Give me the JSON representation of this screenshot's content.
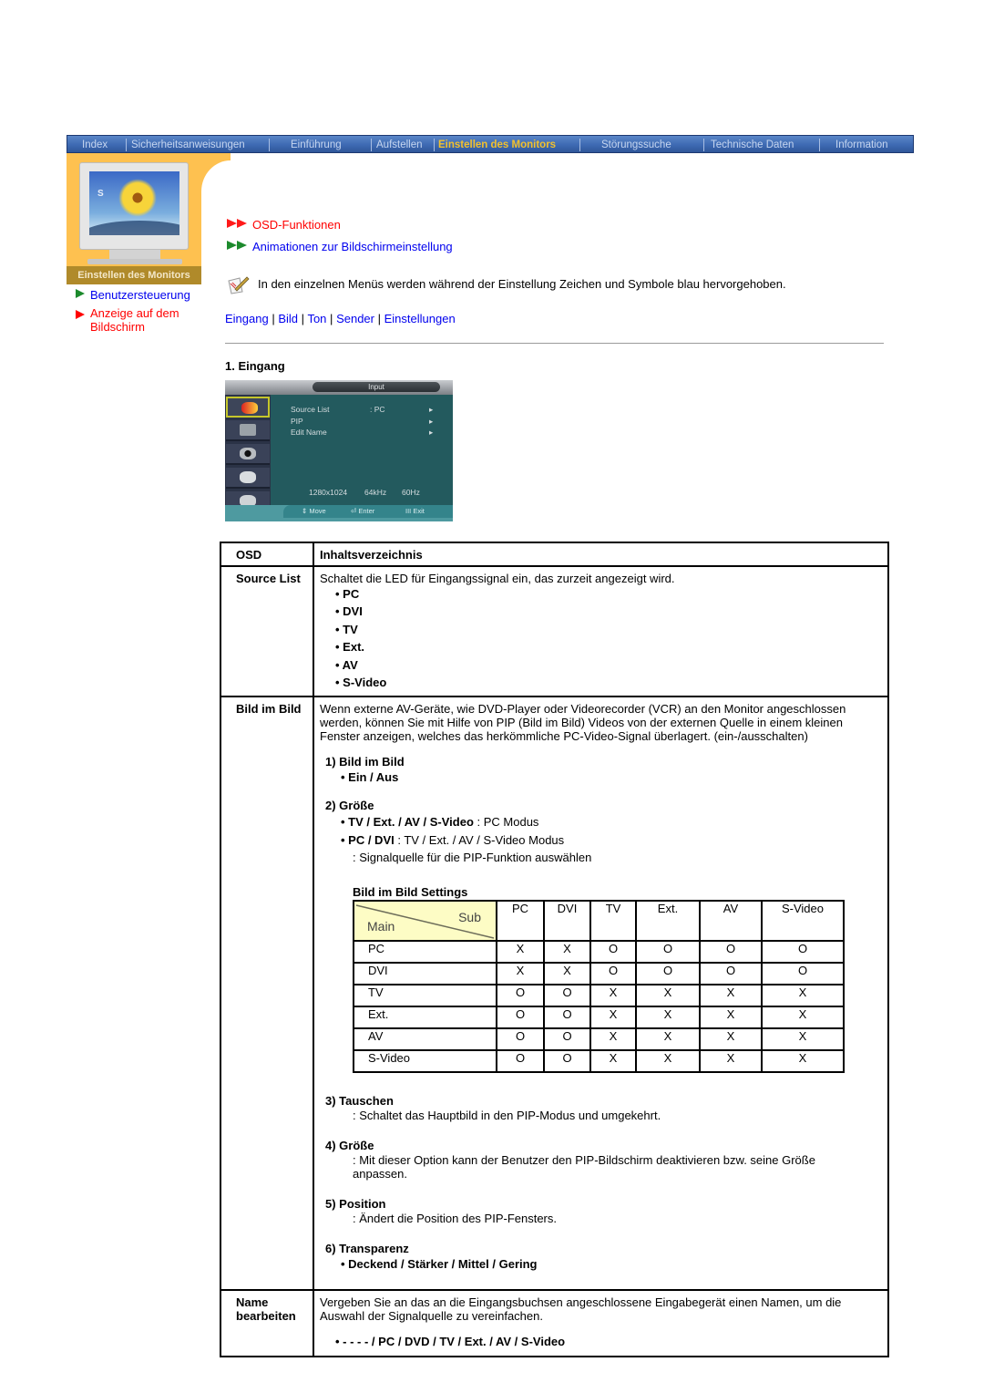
{
  "nav": {
    "items": [
      {
        "label": "Index",
        "active": false
      },
      {
        "label": "Sicherheitsanweisungen",
        "active": false
      },
      {
        "label": "Einführung",
        "active": false
      },
      {
        "label": "Aufstellen",
        "active": false
      },
      {
        "label": "Einstellen des Monitors",
        "active": true
      },
      {
        "label": "Störungssuche",
        "active": false
      },
      {
        "label": "Technische Daten",
        "active": false
      },
      {
        "label": "Information",
        "active": false
      }
    ]
  },
  "sidebar": {
    "panel_title": "Einstellen des Monitors",
    "monitor_letter": "S",
    "links": [
      {
        "label": "Benutzersteuerung",
        "color": "#0000ee",
        "arrow_color": "#1c8a2c"
      },
      {
        "label": "Anzeige auf dem Bildschirm",
        "color": "#ff0000",
        "arrow_color": "#ff0000"
      }
    ]
  },
  "top_links": [
    {
      "label": "OSD-Funktionen",
      "color": "#ff0000",
      "arrow_color": "#ff1a1a"
    },
    {
      "label": "Animationen zur Bildschirmeinstellung",
      "color": "#0000ee",
      "arrow_color": "#1c8a2c"
    }
  ],
  "note": {
    "text": "In den einzelnen Menüs werden während der Einstellung Zeichen und Symbole blau hervorgehoben."
  },
  "breadcrumbs": [
    "Eingang",
    "Bild",
    "Ton",
    "Sender",
    "Einstellungen"
  ],
  "breadcrumb_separator": "|",
  "section_title": "1. Eingang",
  "osd_screen": {
    "title": "Input",
    "menu": [
      {
        "label": "Source List",
        "value": ": PC",
        "arrow": "▸"
      },
      {
        "label": "PIP",
        "value": "",
        "arrow": "▸"
      },
      {
        "label": "Edit Name",
        "value": "",
        "arrow": "▸"
      }
    ],
    "status": [
      "1280x1024",
      "64kHz",
      "60Hz"
    ],
    "footer": [
      "⇕ Move",
      "⏎ Enter",
      "III Exit"
    ]
  },
  "table": {
    "headers": [
      "OSD",
      "Inhaltsverzeichnis"
    ],
    "source_list": {
      "label": "Source List",
      "desc": "Schaltet die LED für Eingangssignal ein, das zurzeit angezeigt wird.",
      "options": [
        "• PC",
        "• DVI",
        "• TV",
        "• Ext.",
        "• AV",
        "• S-Video"
      ]
    },
    "pip": {
      "label": "Bild im Bild",
      "desc": "Wenn externe AV-Geräte, wie DVD-Player oder Videorecorder (VCR) an den Monitor angeschlossen werden, können Sie mit Hilfe von PIP (Bild im Bild) Videos von der externen Quelle in einem kleinen Fenster anzeigen, welches das herkömmliche PC-Video-Signal überlagert. (ein-/ausschalten)",
      "item1_title": "1) Bild im Bild",
      "item1_option": "• Ein / Aus",
      "item2_title": "2) Größe",
      "item2_line1_bold": "• TV / Ext. / AV / S-Video",
      "item2_line1_rest": " : PC Modus",
      "item2_line2_bold": "• PC / DVI",
      "item2_line2_rest": " : TV / Ext. / AV / S-Video Modus",
      "item2_note": ": Signalquelle für die PIP-Funktion auswählen",
      "settings_title": "Bild im Bild Settings",
      "corner_main": "Main",
      "corner_sub": "Sub",
      "columns": [
        "PC",
        "DVI",
        "TV",
        "Ext.",
        "AV",
        "S-Video"
      ],
      "rows": [
        {
          "main": "PC",
          "cells": [
            "X",
            "X",
            "O",
            "O",
            "O",
            "O"
          ]
        },
        {
          "main": "DVI",
          "cells": [
            "X",
            "X",
            "O",
            "O",
            "O",
            "O"
          ]
        },
        {
          "main": "TV",
          "cells": [
            "O",
            "O",
            "X",
            "X",
            "X",
            "X"
          ]
        },
        {
          "main": "Ext.",
          "cells": [
            "O",
            "O",
            "X",
            "X",
            "X",
            "X"
          ]
        },
        {
          "main": "AV",
          "cells": [
            "O",
            "O",
            "X",
            "X",
            "X",
            "X"
          ]
        },
        {
          "main": "S-Video",
          "cells": [
            "O",
            "O",
            "X",
            "X",
            "X",
            "X"
          ]
        }
      ],
      "item3_title": "3) Tauschen",
      "item3_desc": ": Schaltet das Hauptbild in den PIP-Modus und umgekehrt.",
      "item4_title": "4) Größe",
      "item4_desc": ": Mit dieser Option kann der Benutzer den PIP-Bildschirm deaktivieren bzw. seine Größe anpassen.",
      "item5_title": "5) Position",
      "item5_desc": ": Ändert die Position des PIP-Fensters.",
      "item6_title": "6) Transparenz",
      "item6_option": "• Deckend / Stärker / Mittel / Gering"
    },
    "edit_name": {
      "label": "Name bearbeiten",
      "desc": "Vergeben Sie an das an die Eingangsbuchsen angeschlossene Eingabegerät einen Namen, um die Auswahl der Signalquelle zu vereinfachen.",
      "options": "• - - - - / PC / DVD / TV / Ext. / AV / S-Video"
    }
  }
}
